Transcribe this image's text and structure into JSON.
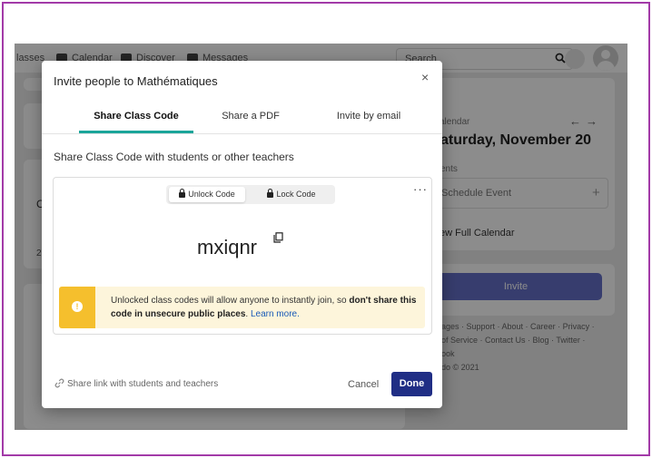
{
  "app": {
    "nav": {
      "classes": "lasses",
      "calendar": "Calendar",
      "discover": "Discover",
      "messages": "Messages"
    },
    "search": {
      "placeholder": "Search"
    },
    "right_panel": {
      "calendar_label": "alendar",
      "date": "aturday, November 20",
      "events_label": "ents",
      "schedule_event": "Schedule Event",
      "view_calendar": "ew Full Calendar",
      "invite_label": "Invite",
      "footer_line1": "ages · Support · About · Career · Privacy ·",
      "footer_line2": "of Service · Contact Us · Blog · Twitter ·",
      "footer_line3": "ook",
      "footer_line4": "do © 2021"
    },
    "left_fragments": {
      "c": "C",
      "two": "2"
    }
  },
  "modal": {
    "title": "Invite people to Mathématiques",
    "close_glyph": "×",
    "tabs": [
      {
        "label": "Share Class Code",
        "active": true
      },
      {
        "label": "Share a PDF",
        "active": false
      },
      {
        "label": "Invite by email",
        "active": false
      }
    ],
    "subheading": "Share Class Code with students or other teachers",
    "toggle": {
      "unlock_label": "Unlock Code",
      "lock_label": "Lock Code",
      "selected": "unlock"
    },
    "more_glyph": "···",
    "class_code": "mxiqnr",
    "warning": {
      "text_plain": "Unlocked class codes will allow anyone to instantly join, so ",
      "text_bold": "don't share this code in unsecure public places",
      "text_end": ". ",
      "link": "Learn more.",
      "icon_glyph": "!",
      "color": "#f5bf2d"
    },
    "share_link": "Share link with students and teachers",
    "cancel_label": "Cancel",
    "done_label": "Done"
  },
  "colors": {
    "frame": "#a33aa8",
    "accent_teal": "#1aa59a",
    "done_button": "#202e85",
    "warning_bg": "#fdf5db"
  }
}
